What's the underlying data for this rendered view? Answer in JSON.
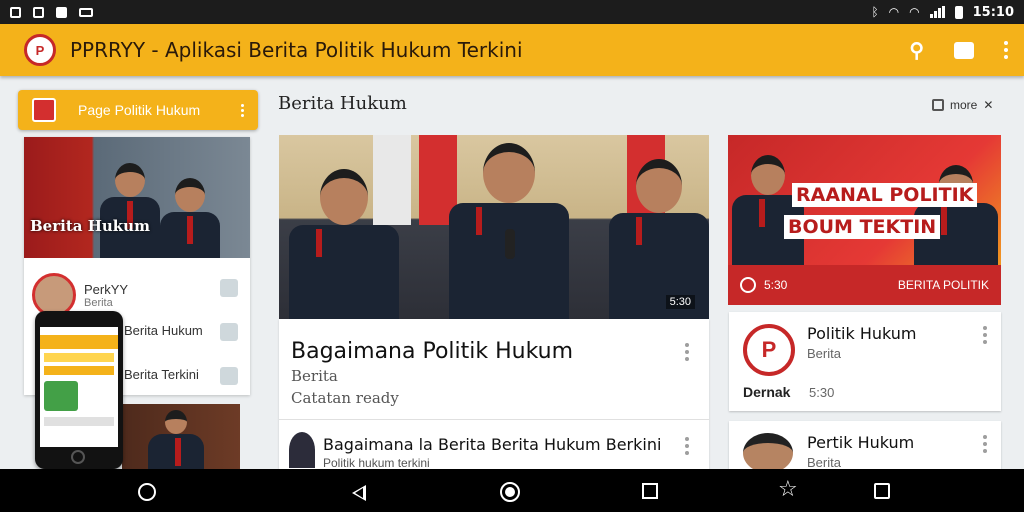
{
  "status_bar": {
    "time": "15:10",
    "icons": [
      "sim-icon",
      "camera-icon",
      "image-icon",
      "keyboard-icon",
      "bluetooth-icon",
      "wifi-icon",
      "wifi-alt-icon",
      "signal-icon",
      "battery-icon"
    ]
  },
  "app_bar": {
    "title": "PPRRYY - Aplikasi Berita Politik Hukum Terkini",
    "actions": [
      "search-icon",
      "chat-icon",
      "more-vert-icon"
    ],
    "accent_color": "#f4b21a"
  },
  "sidebar": {
    "button_label": "Page Politik Hukum",
    "card_caption": "Berita Hukum",
    "items": [
      {
        "title": "PerkYY",
        "subtitle": "Berita"
      },
      {
        "title": "Berita Hukum"
      },
      {
        "title": "Berita Terkini"
      }
    ]
  },
  "feed": {
    "heading": "Berita Hukum",
    "sort_label": "more",
    "main_video_duration": "5:30",
    "main_title": "Bagaimana Politik Hukum",
    "main_sub1": "Berita",
    "main_sub2": "Catatan ready",
    "row_title": "Bagaimana la Berita Berita Hukum Berkini",
    "row_sub": "Politik hukum terkini"
  },
  "right": {
    "banner_line1": "RAANAL POLITIK",
    "banner_line2": "BOUM TEKTIN",
    "banner_foot_left": "5:30",
    "banner_foot_right": "BERITA POLITIK",
    "card1_title": "Politik Hukum",
    "card1_sub": "Berita",
    "card1_foot": "Dernak",
    "card1_foot2": "5:30",
    "card2_title": "Pertik Hukum",
    "card2_sub": "Berita"
  },
  "nav_bar": {
    "icons": [
      "circle-icon",
      "back-icon",
      "home-icon",
      "recents-icon",
      "star-icon",
      "copy-icon"
    ]
  }
}
